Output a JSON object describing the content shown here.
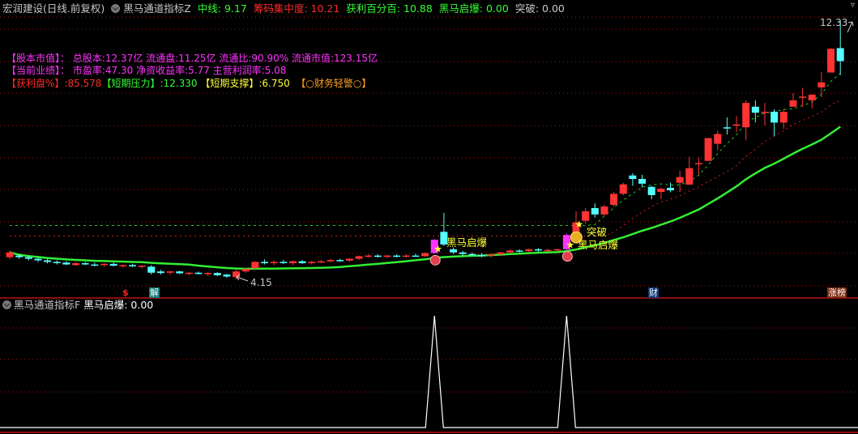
{
  "header": {
    "stock_title": "宏润建设(日线.前复权)",
    "indicator_name": "黑马通道指标Z",
    "items": [
      {
        "label": "中线",
        "value": "9.17",
        "color": "#33ff33"
      },
      {
        "label": "筹码集中度",
        "value": "10.21",
        "color": "#ff2b2b"
      },
      {
        "label": "获利百分百",
        "value": "10.88",
        "color": "#33ff33"
      },
      {
        "label": "黑马启爆",
        "value": "0.00",
        "color": "#33ff33"
      },
      {
        "label": "突破",
        "value": "0.00",
        "color": "#c8c8c8"
      }
    ]
  },
  "info": {
    "row1_title": "【股本市值】：",
    "total_shares": "总股本:12.37亿",
    "float_shares": "流通盘:11.25亿",
    "float_ratio": "流通比:90.90%",
    "float_value": "流通市值:123.15亿",
    "row2_title": "【当前业绩】：",
    "pe": "市盈率:47.30",
    "roe": "净资收益率:5.77",
    "margin": "主营利润率:5.08",
    "profit_label": "【获利盘%】",
    "profit_value": ":85.578",
    "pressure_label": "【短期压力】",
    "pressure_value": ":12.330",
    "support_label": "【短期支撑】",
    "support_value": ":6.750",
    "warning": "【○财务轻警○】"
  },
  "chart_data": {
    "type": "candlestick",
    "title": "宏润建设(日线.前复权)",
    "ylim": [
      4.15,
      12.33
    ],
    "max_label": "12.33",
    "min_label": "4.15",
    "grid": true,
    "ohlc": [
      [
        4.85,
        5.05,
        4.8,
        5.0
      ],
      [
        4.9,
        4.95,
        4.8,
        4.85
      ],
      [
        4.85,
        4.9,
        4.75,
        4.8
      ],
      [
        4.8,
        4.85,
        4.7,
        4.75
      ],
      [
        4.75,
        4.8,
        4.65,
        4.7
      ],
      [
        4.7,
        4.75,
        4.62,
        4.68
      ],
      [
        4.68,
        4.72,
        4.6,
        4.62
      ],
      [
        4.6,
        4.7,
        4.58,
        4.66
      ],
      [
        4.66,
        4.7,
        4.6,
        4.62
      ],
      [
        4.62,
        4.68,
        4.56,
        4.6
      ],
      [
        4.6,
        4.66,
        4.55,
        4.64
      ],
      [
        4.64,
        4.68,
        4.56,
        4.58
      ],
      [
        4.58,
        4.62,
        4.52,
        4.6
      ],
      [
        4.6,
        4.64,
        4.54,
        4.56
      ],
      [
        4.56,
        4.6,
        4.5,
        4.58
      ],
      [
        4.55,
        4.6,
        4.3,
        4.36
      ],
      [
        4.4,
        4.45,
        4.3,
        4.35
      ],
      [
        4.36,
        4.42,
        4.3,
        4.4
      ],
      [
        4.4,
        4.42,
        4.32,
        4.34
      ],
      [
        4.34,
        4.38,
        4.28,
        4.36
      ],
      [
        4.36,
        4.4,
        4.3,
        4.32
      ],
      [
        4.32,
        4.38,
        4.26,
        4.35
      ],
      [
        4.35,
        4.38,
        4.25,
        4.28
      ],
      [
        4.3,
        4.32,
        4.2,
        4.24
      ],
      [
        4.22,
        4.45,
        4.15,
        4.4
      ],
      [
        4.4,
        4.5,
        4.35,
        4.48
      ],
      [
        4.5,
        4.72,
        4.48,
        4.7
      ],
      [
        4.7,
        4.78,
        4.62,
        4.66
      ],
      [
        4.66,
        4.75,
        4.6,
        4.7
      ],
      [
        4.7,
        4.76,
        4.64,
        4.68
      ],
      [
        4.66,
        4.74,
        4.6,
        4.72
      ],
      [
        4.72,
        4.76,
        4.64,
        4.66
      ],
      [
        4.66,
        4.74,
        4.62,
        4.7
      ],
      [
        4.7,
        4.76,
        4.66,
        4.72
      ],
      [
        4.72,
        4.8,
        4.68,
        4.76
      ],
      [
        4.76,
        4.8,
        4.7,
        4.74
      ],
      [
        4.74,
        4.82,
        4.7,
        4.8
      ],
      [
        4.8,
        4.9,
        4.76,
        4.88
      ],
      [
        4.88,
        4.94,
        4.84,
        4.9
      ],
      [
        4.9,
        4.94,
        4.84,
        4.86
      ],
      [
        4.86,
        4.92,
        4.82,
        4.9
      ],
      [
        4.9,
        4.94,
        4.84,
        4.88
      ],
      [
        4.88,
        4.94,
        4.84,
        4.9
      ],
      [
        4.9,
        4.96,
        4.86,
        4.88
      ],
      [
        4.88,
        5.0,
        4.86,
        4.98
      ],
      [
        4.98,
        5.42,
        4.96,
        5.4
      ],
      [
        5.65,
        6.25,
        5.2,
        5.25
      ],
      [
        5.1,
        5.15,
        4.95,
        5.0
      ],
      [
        5.0,
        5.05,
        4.9,
        4.95
      ],
      [
        4.95,
        5.0,
        4.88,
        4.92
      ],
      [
        4.92,
        4.98,
        4.85,
        4.9
      ],
      [
        4.9,
        4.96,
        4.84,
        4.94
      ],
      [
        4.94,
        5.02,
        4.9,
        5.0
      ],
      [
        5.0,
        5.1,
        4.96,
        5.06
      ],
      [
        5.06,
        5.1,
        5.0,
        5.04
      ],
      [
        5.04,
        5.12,
        5.0,
        5.1
      ],
      [
        5.1,
        5.14,
        5.02,
        5.06
      ],
      [
        5.06,
        5.12,
        5.02,
        5.08
      ],
      [
        5.08,
        5.12,
        5.04,
        5.1
      ],
      [
        5.1,
        5.6,
        5.08,
        5.55
      ],
      [
        5.6,
        6.3,
        5.55,
        5.95
      ],
      [
        6.0,
        6.4,
        5.9,
        6.3
      ],
      [
        6.4,
        6.55,
        6.1,
        6.2
      ],
      [
        6.2,
        6.5,
        6.15,
        6.45
      ],
      [
        6.5,
        6.9,
        6.45,
        6.85
      ],
      [
        6.85,
        7.2,
        6.8,
        7.15
      ],
      [
        7.43,
        7.5,
        7.1,
        7.32
      ],
      [
        7.32,
        7.45,
        7.05,
        7.17
      ],
      [
        7.07,
        7.1,
        6.68,
        6.81
      ],
      [
        6.91,
        7.05,
        6.68,
        7.01
      ],
      [
        7.04,
        7.2,
        6.9,
        6.96
      ],
      [
        7.2,
        7.58,
        6.91,
        7.38
      ],
      [
        7.14,
        8.02,
        7.14,
        7.66
      ],
      [
        7.8,
        8.0,
        7.45,
        7.82
      ],
      [
        7.89,
        8.61,
        7.89,
        8.61
      ],
      [
        8.43,
        8.85,
        8.23,
        8.74
      ],
      [
        8.95,
        9.26,
        8.72,
        8.94
      ],
      [
        9.0,
        9.3,
        8.8,
        9.04
      ],
      [
        8.95,
        9.8,
        8.54,
        9.72
      ],
      [
        9.6,
        9.8,
        9.1,
        9.41
      ],
      [
        9.4,
        9.72,
        9.0,
        9.44
      ],
      [
        9.44,
        9.52,
        8.67,
        9.1
      ],
      [
        9.1,
        9.52,
        8.9,
        9.44
      ],
      [
        9.6,
        10.03,
        9.6,
        9.8
      ],
      [
        9.9,
        10.2,
        9.6,
        9.92
      ],
      [
        9.8,
        10.0,
        9.55,
        9.98
      ],
      [
        10.21,
        10.7,
        9.9,
        10.37
      ],
      [
        10.68,
        11.45,
        10.68,
        11.43
      ],
      [
        11.45,
        12.33,
        10.6,
        11.04
      ]
    ],
    "signal_indices": [
      45,
      59
    ],
    "breakout_index": 59,
    "upper_channel_floor": 5.85,
    "lower_channel_floor": 5.52,
    "ma_period": 20,
    "signal_label": "黑马启爆",
    "breakout_label": "突破"
  },
  "badges": {
    "s": "$",
    "jie": "解",
    "cai": "财",
    "zhangbang": "涨榜"
  },
  "sub_panel": {
    "indicator_name": "黑马通道指标F",
    "label": "黑马启爆",
    "value": "0.00"
  },
  "colors": {
    "up": "#ff3333",
    "down": "#55ffff",
    "signal": "#ff33ff",
    "ma": "#33ee33",
    "grid": "#b01010"
  }
}
